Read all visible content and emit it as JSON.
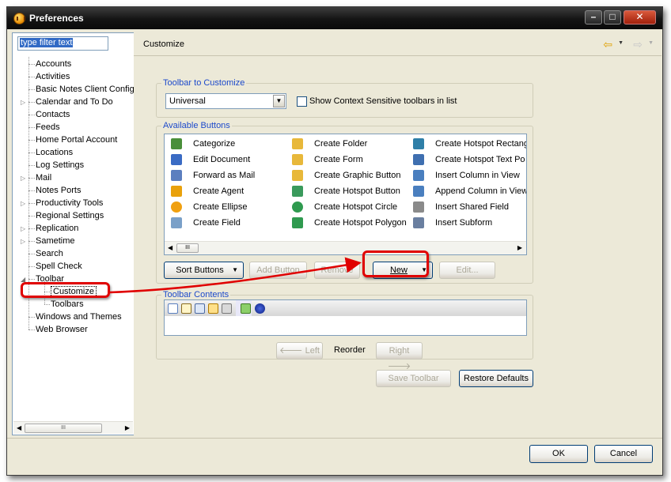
{
  "window": {
    "title": "Preferences",
    "buttons": {
      "minimize": "–",
      "maximize": "□",
      "close": "✕"
    }
  },
  "filter": {
    "placeholder": "type filter text"
  },
  "tree": [
    {
      "label": "Accounts",
      "expandable": false
    },
    {
      "label": "Activities",
      "expandable": false
    },
    {
      "label": "Basic Notes Client Config",
      "expandable": false
    },
    {
      "label": "Calendar and To Do",
      "expandable": true
    },
    {
      "label": "Contacts",
      "expandable": false
    },
    {
      "label": "Feeds",
      "expandable": false
    },
    {
      "label": "Home Portal Account",
      "expandable": false
    },
    {
      "label": "Locations",
      "expandable": false
    },
    {
      "label": "Log Settings",
      "expandable": false
    },
    {
      "label": "Mail",
      "expandable": true
    },
    {
      "label": "Notes Ports",
      "expandable": false
    },
    {
      "label": "Productivity Tools",
      "expandable": true
    },
    {
      "label": "Regional Settings",
      "expandable": false
    },
    {
      "label": "Replication",
      "expandable": true
    },
    {
      "label": "Sametime",
      "expandable": true
    },
    {
      "label": "Search",
      "expandable": false
    },
    {
      "label": "Spell Check",
      "expandable": false
    },
    {
      "label": "Toolbar",
      "expandable": true,
      "expanded": true
    },
    {
      "label": "Customize",
      "child": true,
      "selected": true
    },
    {
      "label": "Toolbars",
      "child": true
    },
    {
      "label": "Windows and Themes",
      "expandable": false
    },
    {
      "label": "Web Browser",
      "expandable": false
    }
  ],
  "page": {
    "title": "Customize"
  },
  "toolbar_to_customize": {
    "label": "Toolbar to Customize",
    "selected": "Universal",
    "checkbox_label": "Show Context Sensitive toolbars in list",
    "checkbox_checked": false
  },
  "available_buttons": {
    "label": "Available Buttons",
    "columns": [
      [
        "Categorize",
        "Edit Document",
        "Forward as Mail",
        "Create Agent",
        "Create Ellipse",
        "Create Field"
      ],
      [
        "Create Folder",
        "Create Form",
        "Create Graphic Button",
        "Create Hotspot Button",
        "Create Hotspot Circle",
        "Create Hotspot Polygon"
      ],
      [
        "Create Hotspot Rectang",
        "Create Hotspot Text Po",
        "Insert Column in View",
        "Append Column in View",
        "Insert Shared Field",
        "Insert Subform"
      ]
    ]
  },
  "actions": {
    "sort": "Sort Buttons",
    "add": "Add Button",
    "remove": "Remove",
    "new": "New",
    "edit": "Edit..."
  },
  "toolbar_contents": {
    "label": "Toolbar Contents"
  },
  "reorder": {
    "left": "Left",
    "label": "Reorder",
    "right": "Right"
  },
  "bottom_actions": {
    "save": "Save Toolbar",
    "restore": "Restore Defaults"
  },
  "dialog": {
    "ok": "OK",
    "cancel": "Cancel"
  },
  "colors": {
    "accent": "#1c49cb",
    "annotation": "#e00000",
    "selection": "#316ac5"
  }
}
